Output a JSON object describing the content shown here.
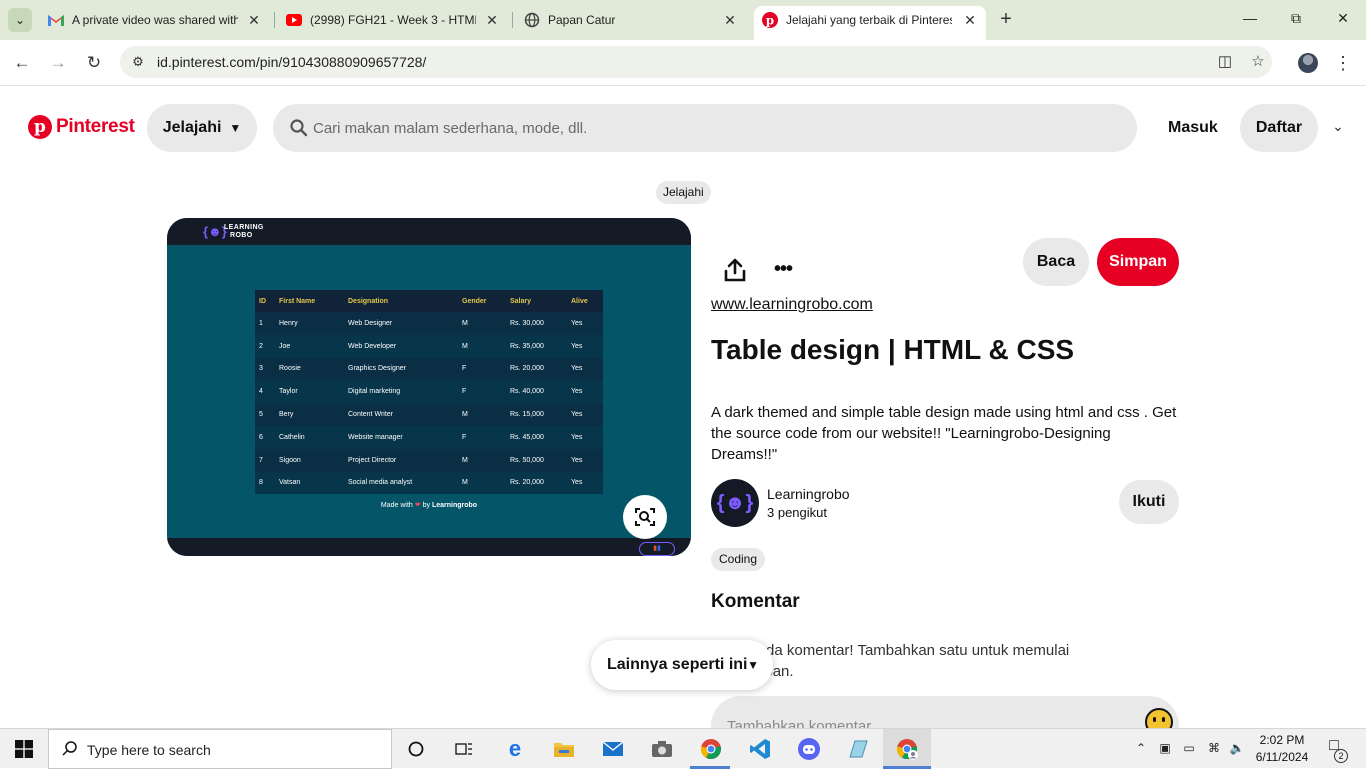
{
  "browser": {
    "tabs": [
      {
        "title": "A private video was shared with",
        "icon": "gmail-icon"
      },
      {
        "title": "(2998) FGH21 - Week 3 - HTML",
        "icon": "youtube-icon"
      },
      {
        "title": "Papan Catur",
        "icon": "globe-icon"
      },
      {
        "title": "Jelajahi yang terbaik di Pinteres",
        "icon": "pinterest-icon",
        "active": true
      }
    ],
    "url": "id.pinterest.com/pin/910430880909657728/"
  },
  "header": {
    "logo_text": "Pinterest",
    "explore_label": "Jelajahi",
    "search_placeholder": "Cari makan malam sederhana, mode, dll.",
    "login_label": "Masuk",
    "signup_label": "Daftar"
  },
  "breadcrumb": "Jelajahi",
  "pin_image": {
    "brand_line1": "LEARNING",
    "brand_line2": "ROBO",
    "table": {
      "headers": [
        "ID",
        "First Name",
        "Designation",
        "Gender",
        "Salary",
        "Alive"
      ],
      "rows": [
        [
          "1",
          "Henry",
          "Web Designer",
          "M",
          "Rs. 30,000",
          "Yes"
        ],
        [
          "2",
          "Joe",
          "Web Developer",
          "M",
          "Rs. 35,000",
          "Yes"
        ],
        [
          "3",
          "Roosie",
          "Graphics Designer",
          "F",
          "Rs. 20,000",
          "Yes"
        ],
        [
          "4",
          "Taylor",
          "Digital marketing",
          "F",
          "Rs. 40,000",
          "Yes"
        ],
        [
          "5",
          "Bery",
          "Content Writer",
          "M",
          "Rs. 15,000",
          "Yes"
        ],
        [
          "6",
          "Cathelin",
          "Website manager",
          "F",
          "Rs. 45,000",
          "Yes"
        ],
        [
          "7",
          "Sigoon",
          "Project Director",
          "M",
          "Rs. 50,000",
          "Yes"
        ],
        [
          "8",
          "Vatsan",
          "Social media analyst",
          "M",
          "Rs. 20,000",
          "Yes"
        ]
      ]
    },
    "made_with_prefix": "Made with",
    "made_with_suffix": "by",
    "made_with_brand": "Learningrobo"
  },
  "pin": {
    "read_label": "Baca",
    "save_label": "Simpan",
    "source": "www.learningrobo.com",
    "title": "Table design | HTML & CSS",
    "description": "A dark themed and simple table design made using html and css . Get the source code from our website!! \"Learningrobo-Designing Dreams!!\"",
    "creator_name": "Learningrobo",
    "creator_followers": "3 pengikut",
    "follow_label": "Ikuti",
    "tag": "Coding",
    "comments_heading": "Komentar",
    "comments_empty": "Belum ada komentar! Tambahkan satu untuk memulai percakapan.",
    "comment_placeholder": "Tambahkan komentar",
    "more_like_this": "Lainnya seperti ini"
  },
  "taskbar": {
    "search_placeholder": "Type here to search",
    "time": "2:02 PM",
    "date": "6/11/2024",
    "notification_count": "2"
  },
  "colors": {
    "pinterest_red": "#e60023",
    "image_teal": "#045568"
  }
}
